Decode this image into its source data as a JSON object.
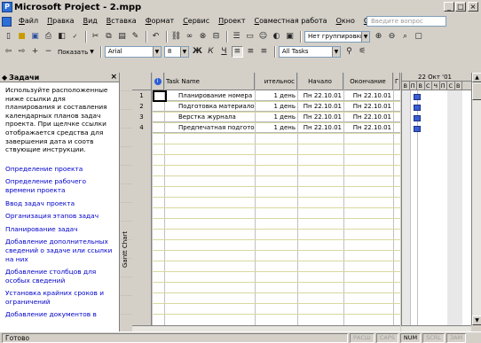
{
  "window": {
    "title": "Microsoft Project - 2.mpp",
    "minimize": "_",
    "maximize": "□",
    "close": "×"
  },
  "menu": {
    "items": [
      "Файл",
      "Правка",
      "Вид",
      "Вставка",
      "Формат",
      "Сервис",
      "Проект",
      "Совместная работа",
      "Окно",
      "Справка"
    ],
    "help_placeholder": "Введите вопрос",
    "doc_controls": [
      "▾",
      "×"
    ]
  },
  "toolbar1": {
    "grouping": "Нет группировки",
    "zoom_in": "⊕",
    "zoom_out": "⊖"
  },
  "toolbar2": {
    "show_label": "Показать",
    "font": "Arial",
    "font_size": "8",
    "bold": "Ж",
    "italic": "К",
    "underline": "Ч",
    "filter": "All Tasks"
  },
  "task_pane": {
    "title": "Задачи",
    "intro": "Используйте расположенные ниже ссылки для планирования и составления календарных планов задач проекта. При щелчке ссылки отображается средства для завершения дата и соотв ствующие инструкции.",
    "links": [
      "Определение проекта",
      "Определение рабочего времени проекта",
      "Ввод задач проекта",
      "Организация этапов задач",
      "Планирование задач",
      "Добавление дополнительных сведений о задаче или ссылки на них",
      "Добавление столбцов для особых сведений",
      "Установка крайних сроков и ограничений",
      "Добавление документов в"
    ]
  },
  "view_bar": {
    "label": "Gantt Chart"
  },
  "table": {
    "columns": [
      "",
      "i",
      "Task Name",
      "ительнос",
      "Начало",
      "Окончание",
      "Г"
    ],
    "rows": [
      {
        "id": "1",
        "name": "Планирование номера",
        "duration": "1 день",
        "start": "Пн 22.10.01",
        "finish": "Пн 22.10.01"
      },
      {
        "id": "2",
        "name": "Подготовка материалов",
        "duration": "1 день",
        "start": "Пн 22.10.01",
        "finish": "Пн 22.10.01"
      },
      {
        "id": "3",
        "name": "Верстка журнала",
        "duration": "1 день",
        "start": "Пн 22.10.01",
        "finish": "Пн 22.10.01"
      },
      {
        "id": "4",
        "name": "Предпечатная подготовка",
        "duration": "1 день",
        "start": "Пн 22.10.01",
        "finish": "Пн 22.10.01"
      }
    ]
  },
  "gantt": {
    "week_label": "22 Окт '01",
    "days": [
      "В",
      "П",
      "В",
      "С",
      "Ч",
      "П",
      "С",
      "В"
    ],
    "bar_color": "#3a5fd0"
  },
  "status": {
    "text": "Готово",
    "indicators": [
      {
        "label": "РАСШ",
        "active": false
      },
      {
        "label": "CAPS",
        "active": false
      },
      {
        "label": "NUM",
        "active": true
      },
      {
        "label": "SCRL",
        "active": false
      },
      {
        "label": "ЗАМ",
        "active": false
      }
    ]
  }
}
